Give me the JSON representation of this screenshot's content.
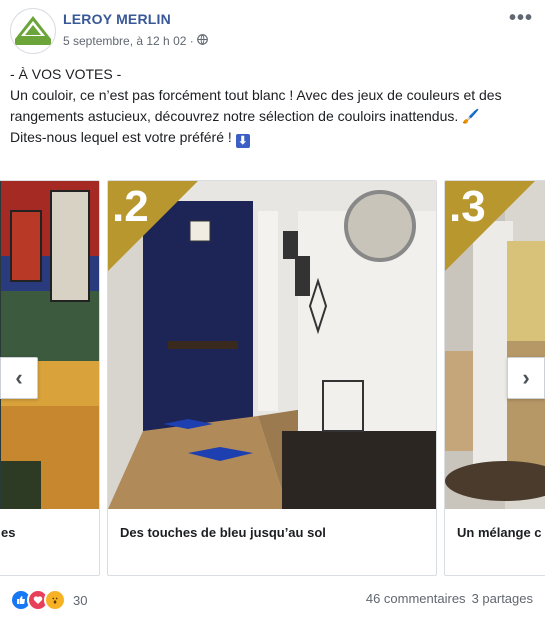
{
  "header": {
    "page_name": "LEROY MERLIN",
    "logo_text": "LEROY MERLIN",
    "timestamp": "5 septembre, à 12 h 02 ·",
    "privacy_icon": "globe-icon",
    "more_icon": "more-options-icon"
  },
  "post": {
    "line1": "- À VOS VOTES -",
    "line2": "Un couloir, ce n’est pas forcément tout blanc ! Avec des jeux de couleurs et des rangements astucieux, découvrez notre sélection de couloirs inattendus. 🖌️",
    "line3": "Dites-nous lequel est votre préféré !",
    "arrow_emoji": "⬇"
  },
  "carousel": {
    "cards": [
      {
        "caption": "es",
        "badge": ""
      },
      {
        "caption": "Des touches de bleu jusqu’au sol",
        "badge": ".2"
      },
      {
        "caption": "Un mélange c",
        "badge": ".3"
      }
    ],
    "prev_icon": "chevron-left-icon",
    "next_icon": "chevron-right-icon",
    "prev_glyph": "‹",
    "next_glyph": "›"
  },
  "footer": {
    "reaction_count": "30",
    "reaction_icons": [
      "like-icon",
      "love-icon",
      "wow-icon"
    ],
    "comments": "46 commentaires",
    "shares": "3 partages"
  },
  "colors": {
    "link_blue": "#385898",
    "badge_gold": "#b8982e",
    "logo_green": "#6ba539",
    "like_blue": "#1877f2",
    "love_red": "#e9405a",
    "wow_yellow": "#f7b125"
  }
}
